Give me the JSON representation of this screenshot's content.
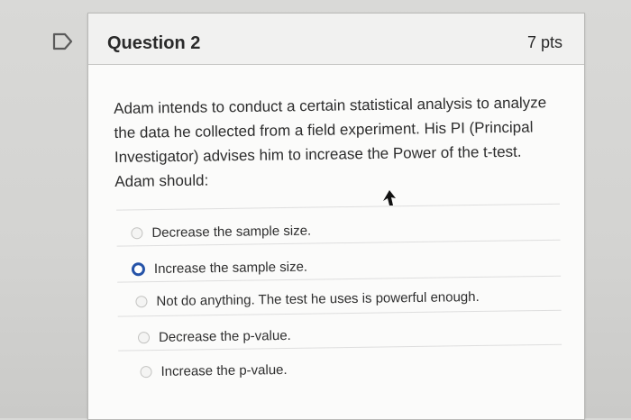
{
  "question": {
    "title": "Question 2",
    "points": "7 pts",
    "text": "Adam intends to conduct a certain statistical analysis to analyze the data he collected from a field experiment. His PI (Principal Investigator) advises him to increase the Power of the t-test. Adam should:"
  },
  "answers": [
    {
      "label": "Decrease the sample size.",
      "selected": false
    },
    {
      "label": "Increase the sample size.",
      "selected": true
    },
    {
      "label": "Not do anything. The test he uses is powerful enough.",
      "selected": false
    },
    {
      "label": "Decrease the p-value.",
      "selected": false
    },
    {
      "label": "Increase the p-value.",
      "selected": false
    }
  ],
  "colors": {
    "selected_radio": "#2553a8",
    "flag_icon": "#5a5a5a"
  },
  "icons": [
    "flag-question-icon",
    "mouse-cursor-icon"
  ]
}
